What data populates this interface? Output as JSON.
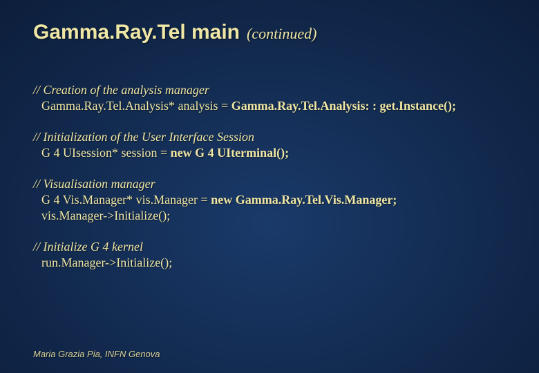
{
  "title": {
    "main": "Gamma.Ray.Tel main",
    "sub": "(continued)"
  },
  "blocks": [
    {
      "comment": "// Creation of the analysis manager",
      "lines": [
        {
          "plain": "Gamma.Ray.Tel.Analysis* analysis = ",
          "bold": "Gamma.Ray.Tel.Analysis: : get.Instance();"
        }
      ]
    },
    {
      "comment": "// Initialization of the User Interface Session",
      "lines": [
        {
          "plain": "G 4 UIsession* session =  ",
          "bold": "new G 4 UIterminal();"
        }
      ]
    },
    {
      "comment": "// Visualisation manager",
      "lines": [
        {
          "plain": "G 4 Vis.Manager* vis.Manager = ",
          "bold": "new Gamma.Ray.Tel.Vis.Manager;"
        },
        {
          "plain": "vis.Manager->Initialize();",
          "bold": ""
        }
      ]
    },
    {
      "comment": "// Initialize G 4 kernel",
      "lines": [
        {
          "plain": "run.Manager->Initialize();",
          "bold": ""
        }
      ]
    }
  ],
  "footer": "Maria Grazia Pia, INFN Genova"
}
